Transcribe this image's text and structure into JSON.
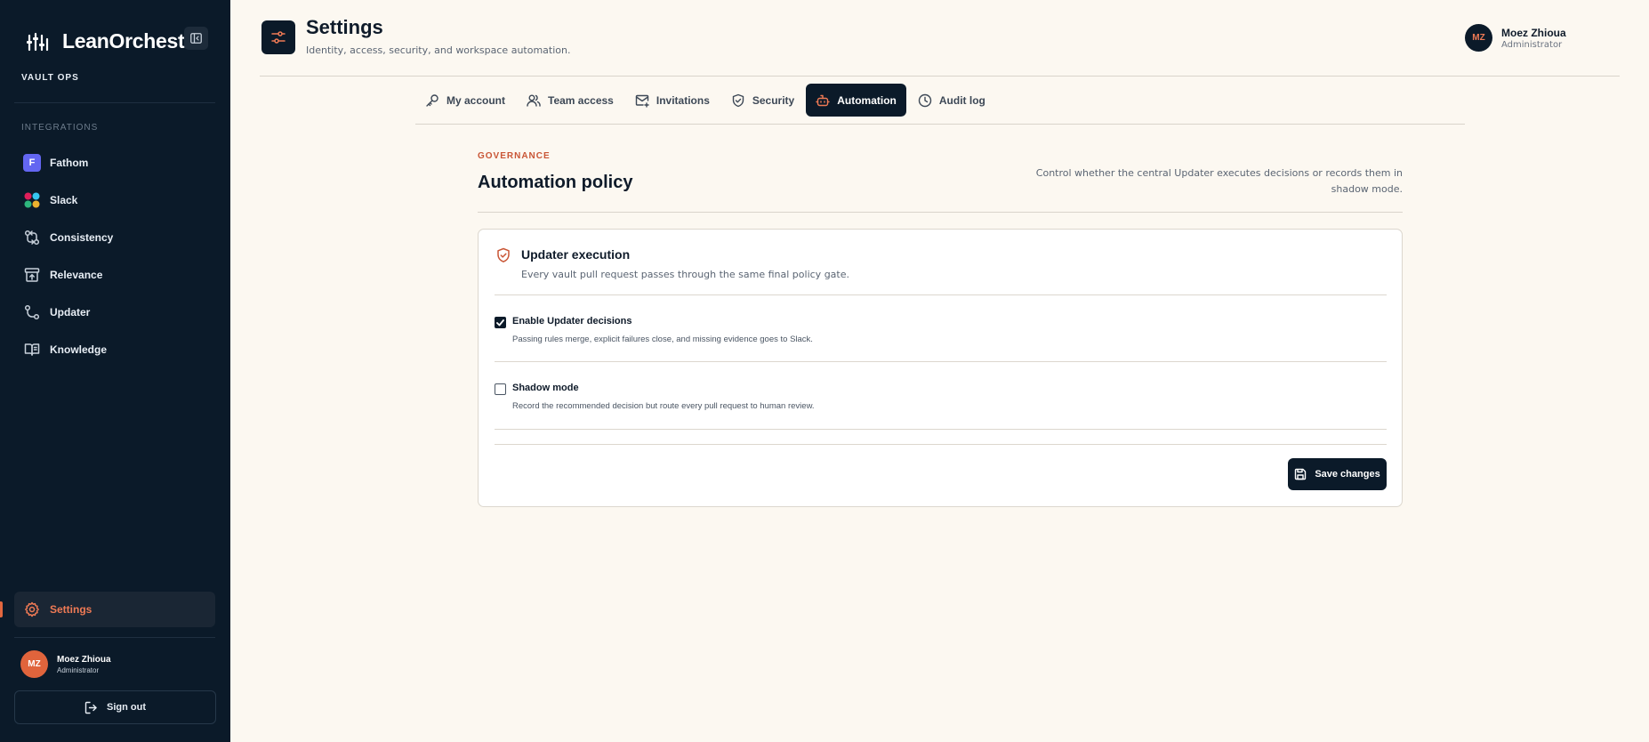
{
  "sidebar": {
    "brand": "LeanOrchestr",
    "workspace": "VAULT OPS",
    "section_label": "INTEGRATIONS",
    "fathom_badge": "F",
    "items": [
      {
        "label": "Fathom",
        "icon": "fathom-icon"
      },
      {
        "label": "Slack",
        "icon": "slack-icon"
      },
      {
        "label": "Consistency",
        "icon": "git-compare-icon"
      },
      {
        "label": "Relevance",
        "icon": "archive-upload-icon"
      },
      {
        "label": "Updater",
        "icon": "git-branch-icon"
      },
      {
        "label": "Knowledge",
        "icon": "book-open-icon"
      }
    ],
    "settings_label": "Settings",
    "user": {
      "initials": "MZ",
      "name": "Moez Zhioua",
      "role": "Administrator"
    },
    "signout_label": "Sign out"
  },
  "header": {
    "title": "Settings",
    "subtitle": "Identity, access, security, and workspace automation.",
    "user": {
      "initials": "MZ",
      "name": "Moez Zhioua",
      "role": "Administrator"
    }
  },
  "tabs": [
    {
      "label": "My account",
      "icon": "key-icon",
      "active": false
    },
    {
      "label": "Team access",
      "icon": "users-icon",
      "active": false
    },
    {
      "label": "Invitations",
      "icon": "mail-plus-icon",
      "active": false
    },
    {
      "label": "Security",
      "icon": "shield-check-icon",
      "active": false
    },
    {
      "label": "Automation",
      "icon": "bot-icon",
      "active": true
    },
    {
      "label": "Audit log",
      "icon": "clock-icon",
      "active": false
    }
  ],
  "section": {
    "eyebrow": "GOVERNANCE",
    "title": "Automation policy",
    "description": "Control whether the central Updater executes decisions or records them in shadow mode."
  },
  "card": {
    "title": "Updater execution",
    "subtitle": "Every vault pull request passes through the same final policy gate.",
    "options": [
      {
        "title": "Enable Updater decisions",
        "description": "Passing rules merge, explicit failures close, and missing evidence goes to Slack.",
        "checked": true
      },
      {
        "title": "Shadow mode",
        "description": "Record the recommended decision but route every pull request to human review.",
        "checked": false
      }
    ],
    "save_label": "Save changes"
  },
  "colors": {
    "sidebar_bg": "#0b1a29",
    "accent": "#e2673f",
    "page_bg": "#fcf8f1",
    "fathom": "#6366f1"
  }
}
